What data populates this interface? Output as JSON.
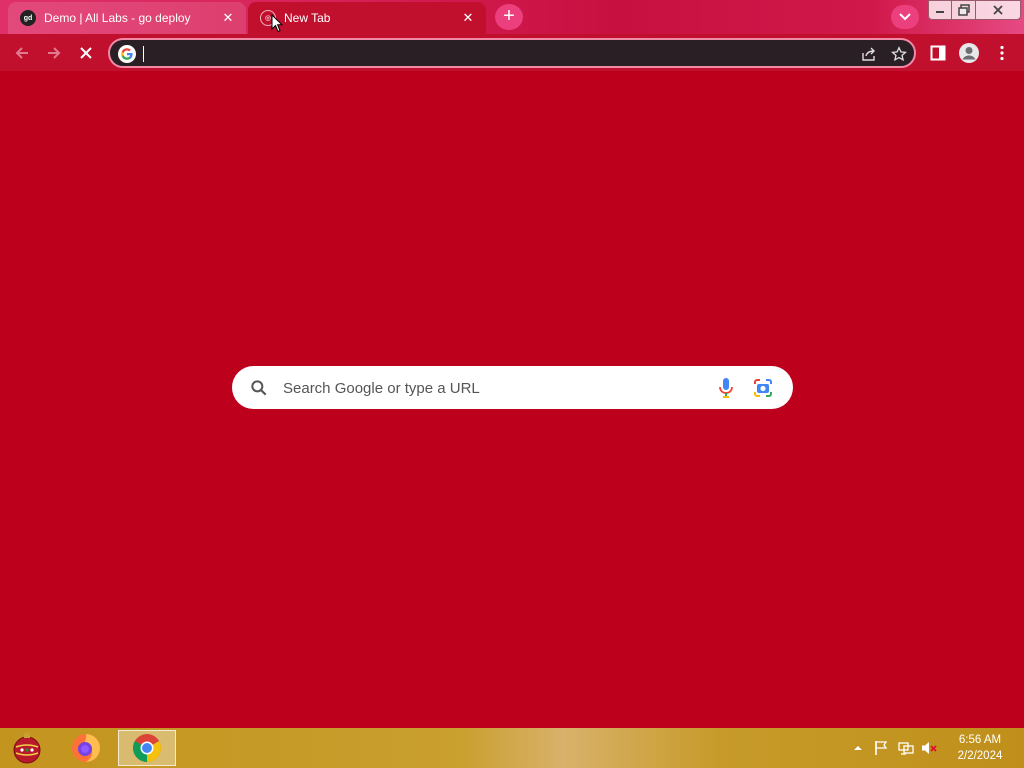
{
  "browser": {
    "tabs": [
      {
        "title": "Demo | All Labs - go deploy",
        "favicon": "go-deploy-logo-icon",
        "active": false
      },
      {
        "title": "New Tab",
        "favicon": "chrome-loading-icon",
        "active": true
      }
    ],
    "close_glyph": "✕",
    "new_tab_glyph": "+",
    "address_bar": {
      "value": "",
      "placeholder": ""
    },
    "accent_color": "#c0102e"
  },
  "new_tab_page": {
    "background_color": "#bd001c",
    "search_placeholder": "Search Google or type a URL"
  },
  "taskbar": {
    "pinned": [
      "start-orb",
      "firefox",
      "chrome"
    ],
    "clock": {
      "time": "6:56 AM",
      "date": "2/2/2024"
    }
  }
}
